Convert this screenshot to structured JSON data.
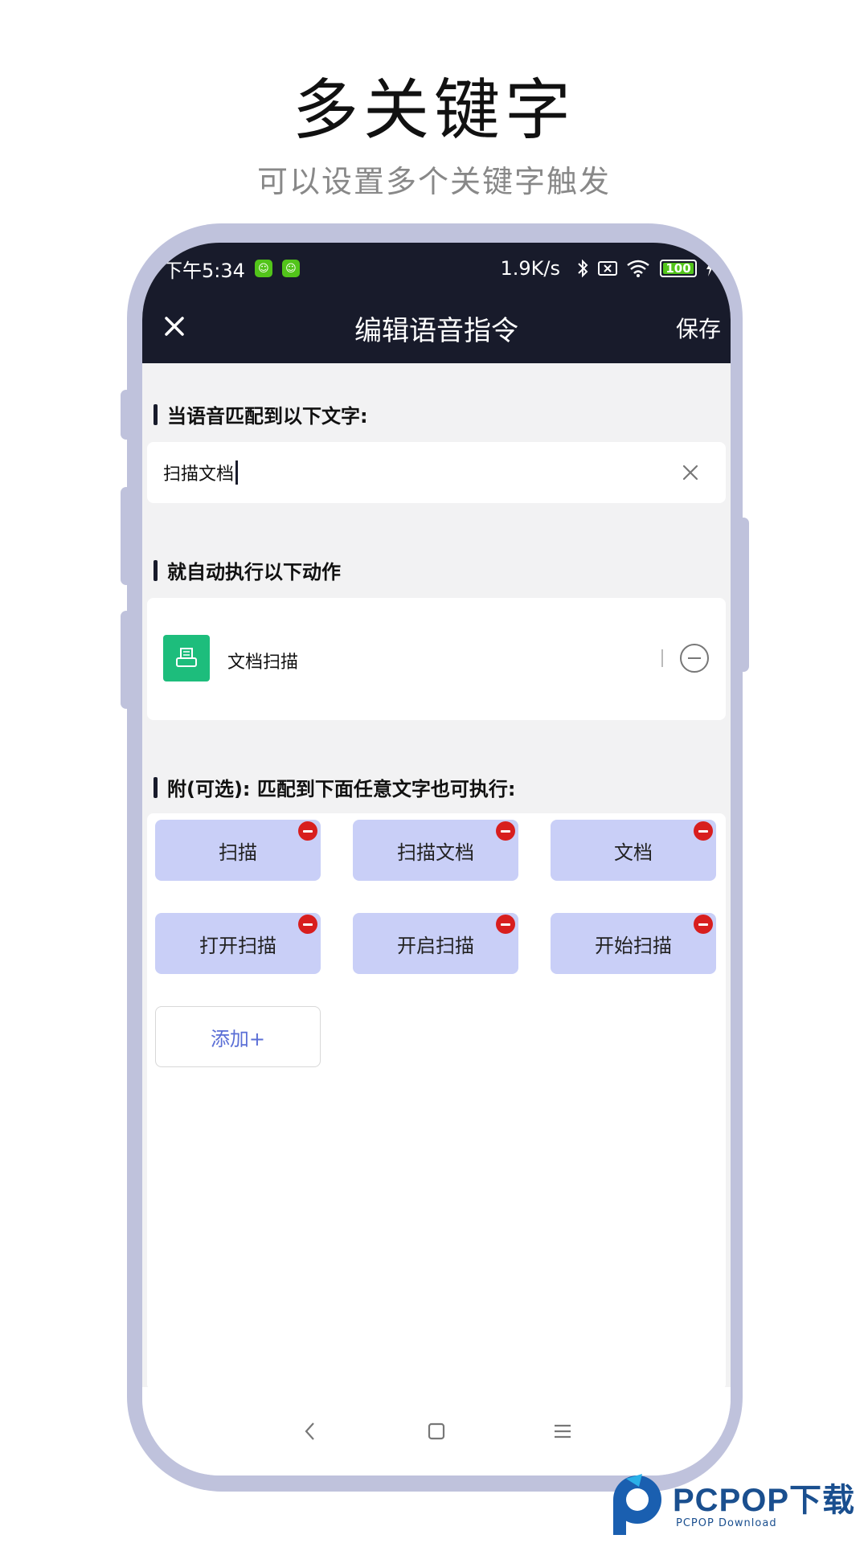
{
  "promo": {
    "title": "多关键字",
    "subtitle": "可以设置多个关键字触发"
  },
  "status_bar": {
    "time": "下午5:34",
    "speed": "1.9K/s",
    "battery": "100"
  },
  "app_bar": {
    "title": "编辑语音指令",
    "save_label": "保存"
  },
  "match_section": {
    "label": "当语音匹配到以下文字:",
    "input_value": "扫描文档"
  },
  "action_section": {
    "label": "就自动执行以下动作",
    "action_name": "文档扫描",
    "action_color": "#1dbd7c"
  },
  "keywords_section": {
    "label": "附(可选): 匹配到下面任意文字也可执行:",
    "keywords": [
      "扫描",
      "扫描文档",
      "文档",
      "打开扫描",
      "开启扫描",
      "开始扫描"
    ],
    "add_label": "添加+",
    "chip_color": "#c9cff7",
    "remove_color": "#d81e1e"
  },
  "watermark": {
    "text": "PCPOP下载",
    "sub": "PCPOP Download"
  }
}
